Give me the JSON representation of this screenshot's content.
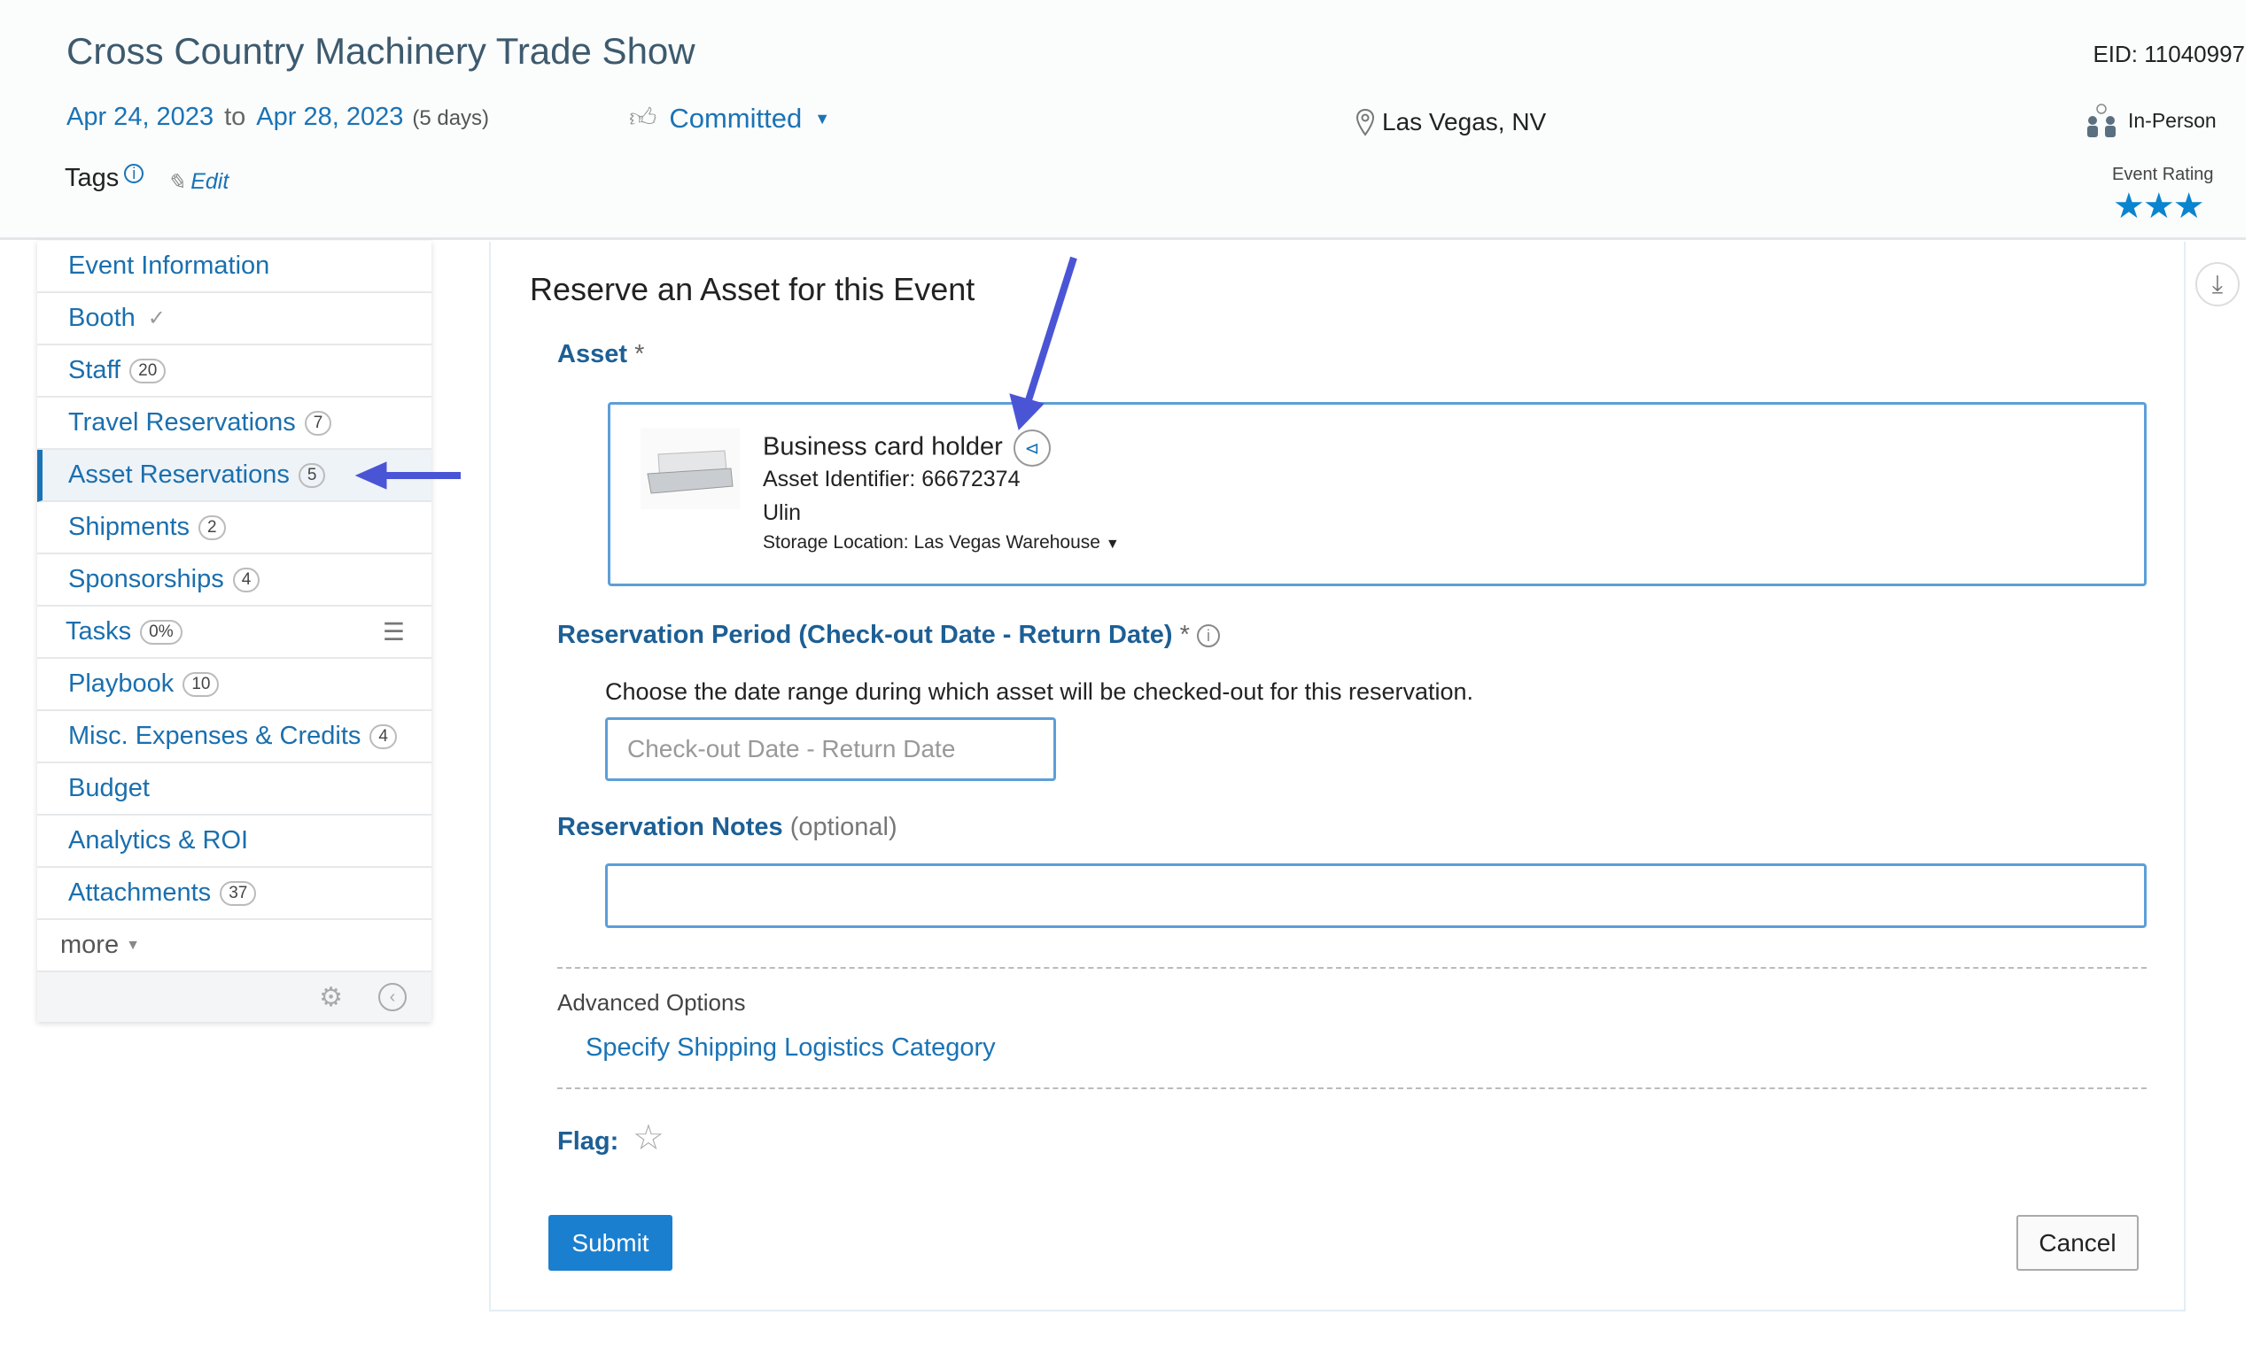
{
  "header": {
    "title": "Cross Country Machinery Trade Show",
    "start_date": "Apr 24, 2023",
    "to": "to",
    "end_date": "Apr 28, 2023",
    "duration": "(5 days)",
    "status": "Committed",
    "location": "Las Vegas, NV",
    "eid": "EID: 11040997",
    "format": "In-Person",
    "tags_label": "Tags",
    "edit_label": "Edit",
    "rating_label": "Event Rating",
    "rating": 3
  },
  "sidebar": {
    "items": [
      {
        "label": "Event Information"
      },
      {
        "label": "Booth"
      },
      {
        "label": "Staff",
        "badge": "20"
      },
      {
        "label": "Travel Reservations",
        "badge": "7"
      },
      {
        "label": "Asset Reservations",
        "badge": "5"
      },
      {
        "label": "Shipments",
        "badge": "2"
      },
      {
        "label": "Sponsorships",
        "badge": "4"
      },
      {
        "label": "Tasks",
        "badge": "0%"
      },
      {
        "label": "Playbook",
        "badge": "10"
      },
      {
        "label": "Misc. Expenses & Credits",
        "badge": "4"
      },
      {
        "label": "Budget"
      },
      {
        "label": "Analytics & ROI"
      },
      {
        "label": "Attachments",
        "badge": "37"
      }
    ],
    "more": "more"
  },
  "form": {
    "heading": "Reserve an Asset for this Event",
    "asset_label": "Asset",
    "required": "*",
    "asset": {
      "name": "Business card holder",
      "identifier": "Asset Identifier: 66672374",
      "owner": "Ulin",
      "storage": "Storage Location: Las Vegas Warehouse"
    },
    "period_label": "Reservation Period (Check-out Date - Return Date)",
    "period_help": "Choose the date range during which asset will be checked-out for this reservation.",
    "period_placeholder": "Check-out Date - Return Date",
    "notes_label": "Reservation Notes",
    "notes_optional": "(optional)",
    "notes_value": "",
    "advanced_label": "Advanced Options",
    "shipping_link": "Specify Shipping Logistics Category",
    "flag_label": "Flag:",
    "submit": "Submit",
    "cancel": "Cancel"
  },
  "colors": {
    "accent": "#1a73b5",
    "annotation_arrow": "#4a55d6",
    "star": "#0b84cf"
  }
}
